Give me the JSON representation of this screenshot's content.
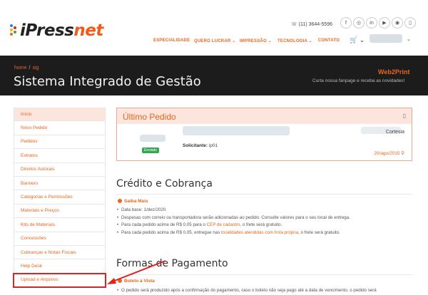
{
  "brand": {
    "logo_i": "i",
    "logo_press": "Press",
    "logo_net": "net",
    "dot_colors": [
      "#2f7fd8",
      "#e3201b",
      "#f5b500",
      "#2fa84f",
      "#e8661e"
    ]
  },
  "header": {
    "phone": "☏ (11) 3644-5596",
    "social_icons": [
      "facebook-icon",
      "instagram-icon",
      "linkedin-icon",
      "youtube-icon",
      "podcast-icon",
      "trash-icon"
    ],
    "nav": [
      "ESPECIALIDADE",
      "QUERO LUCRAR ⌄",
      "IMPRESSÃO ⌄",
      "TECNOLOGIA ⌄",
      "CONTATO"
    ],
    "cart": "🛒 ⌄",
    "user_chevron": "⌄"
  },
  "banner": {
    "crumb_home": "home",
    "crumb_sep": "/",
    "crumb_current": "sig",
    "title": "Sistema Integrado de Gestão",
    "web2print": "Web2Print",
    "web2print_sub": "Curta nossa fanpage e receba as novidades!"
  },
  "sidebar": {
    "items": [
      "Início",
      "Novo Pedido",
      "Pedidos",
      "Extratos",
      "Direitos Autorais",
      "Banners",
      "Categorias e Permissões",
      "Materiais e Preços",
      "Kits de Materiais",
      "Concessões",
      "Cobranças e Notas Fiscais",
      "Help Desk",
      "Upload e Arquivos"
    ],
    "active_index": 0,
    "highlight_index": 12
  },
  "order": {
    "title": "Último Pedido",
    "doc_icon": "▯",
    "cortesia": "Cortesia",
    "status": "Enviado",
    "solicitante_label": "Solicitante:",
    "solicitante_value": " ip01",
    "date": "20/ago/2015 ⚲"
  },
  "credito": {
    "title": "Crédito e Cobrança",
    "sub": "Saiba Mais",
    "bullets": [
      {
        "pre": "Data base: 1/dez/2020.",
        "link": "",
        "post": ""
      },
      {
        "pre": "Despesas com correio ou transportadora serão adicionadas ao pedido. Consulte valores para o seu local de entrega.",
        "link": "",
        "post": ""
      },
      {
        "pre": "Para cada pedido acima de R$ 0,05 para o ",
        "link": "CEP de cadastro",
        "post": ", o frete será gratuito."
      },
      {
        "pre": "Para cada pedido acima de R$ 0,05, entregue nas ",
        "link": "localidades atendidas com frota própria",
        "post": ", o frete será gratuito."
      }
    ]
  },
  "pagamento": {
    "title": "Formas de Pagamento",
    "sub": "Boleto à Vista",
    "line": "O pedido será produzido após a confirmação do pagamento, caso o boleto não seja pago até a data de vencimento, o pedido será"
  },
  "accent": "#e8661e",
  "annotation_color": "#e3201b"
}
